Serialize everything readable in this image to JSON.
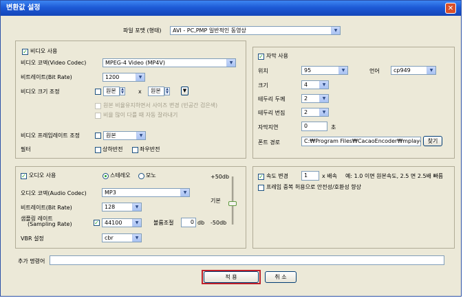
{
  "window": {
    "title": "변환값 설정",
    "close_glyph": "✕"
  },
  "file_format": {
    "label": "파일 포맷 (형태)",
    "value": "AVI - PC,PMP 일반적인 동영상"
  },
  "video": {
    "enable_label": "비디오 사용",
    "enabled": true,
    "codec_label": "비디오 코덱(Video Codec)",
    "codec_value": "MPEG-4 Video (MP4V)",
    "bitrate_label": "비트레이트(Bit Rate)",
    "bitrate_value": "1200",
    "size_label": "비디오 크기 조정",
    "size_w": "원본",
    "size_x": "x",
    "size_h": "원본",
    "size_apply_glyph": "▼",
    "keep_ratio_label": "원본 비율유지하면서 사이즈 변경 (빈공간 검은색)",
    "crop_label": "비율 많이 다를 때 자동 잘라내기",
    "framerate_label": "비디오 프레임레이트 조정",
    "framerate_value": "원본",
    "filter_label": "필터",
    "flip_v_label": "상하반전",
    "flip_h_label": "좌우반전"
  },
  "subtitle": {
    "enable_label": "자막 사용",
    "enabled": true,
    "position_label": "위치",
    "position_value": "95",
    "language_label": "언어",
    "language_value": "cp949",
    "size_label": "크기",
    "size_value": "4",
    "border_label": "테두리 두께",
    "border_value": "2",
    "blur_label": "테두리 번짐",
    "blur_value": "2",
    "delay_label": "자막지연",
    "delay_value": "0",
    "delay_unit": "초",
    "font_path_label": "폰트 경로",
    "font_path_value": "C:₩Program Files₩CacaoEncoder₩mplaye",
    "browse_label": "찾기"
  },
  "audio": {
    "enable_label": "오디오 사용",
    "enabled": true,
    "stereo_label": "스테레오",
    "mono_label": "모노",
    "stereo_selected": true,
    "codec_label": "오디오 코덱(Audio Codec)",
    "codec_value": "MP3",
    "bitrate_label": "비트레이트(Bit Rate)",
    "bitrate_value": "128",
    "sampling_label_1": "샘플링 레이트",
    "sampling_label_2": "(Sampling Rate)",
    "sampling_checked": true,
    "sampling_value": "44100",
    "volume_label": "볼륨조절",
    "volume_value": "0",
    "volume_unit": "db",
    "vbr_label": "VBR 설정",
    "vbr_value": "cbr",
    "slider_max": "+50db",
    "slider_mid": "기본",
    "slider_min": "-50db",
    "slider_level": 0.5
  },
  "speed": {
    "enable_label": "속도 변경",
    "enabled": true,
    "value": "1",
    "unit": "x 배속",
    "example": "예: 1.0 이면 원본속도, 2.5 면 2.5배 빠름",
    "frame_dup_label": "프레임 중복 허용으로 안전성/호환성 향상",
    "frame_dup_checked": false
  },
  "extra": {
    "label": "추가 명령어",
    "value": ""
  },
  "buttons": {
    "apply": "적 용",
    "cancel": "취 소"
  },
  "colors": {
    "title_bar": "#1d5ad6",
    "face": "#ece9d8",
    "check": "#21a121",
    "focus_ring": "#c0202a"
  }
}
